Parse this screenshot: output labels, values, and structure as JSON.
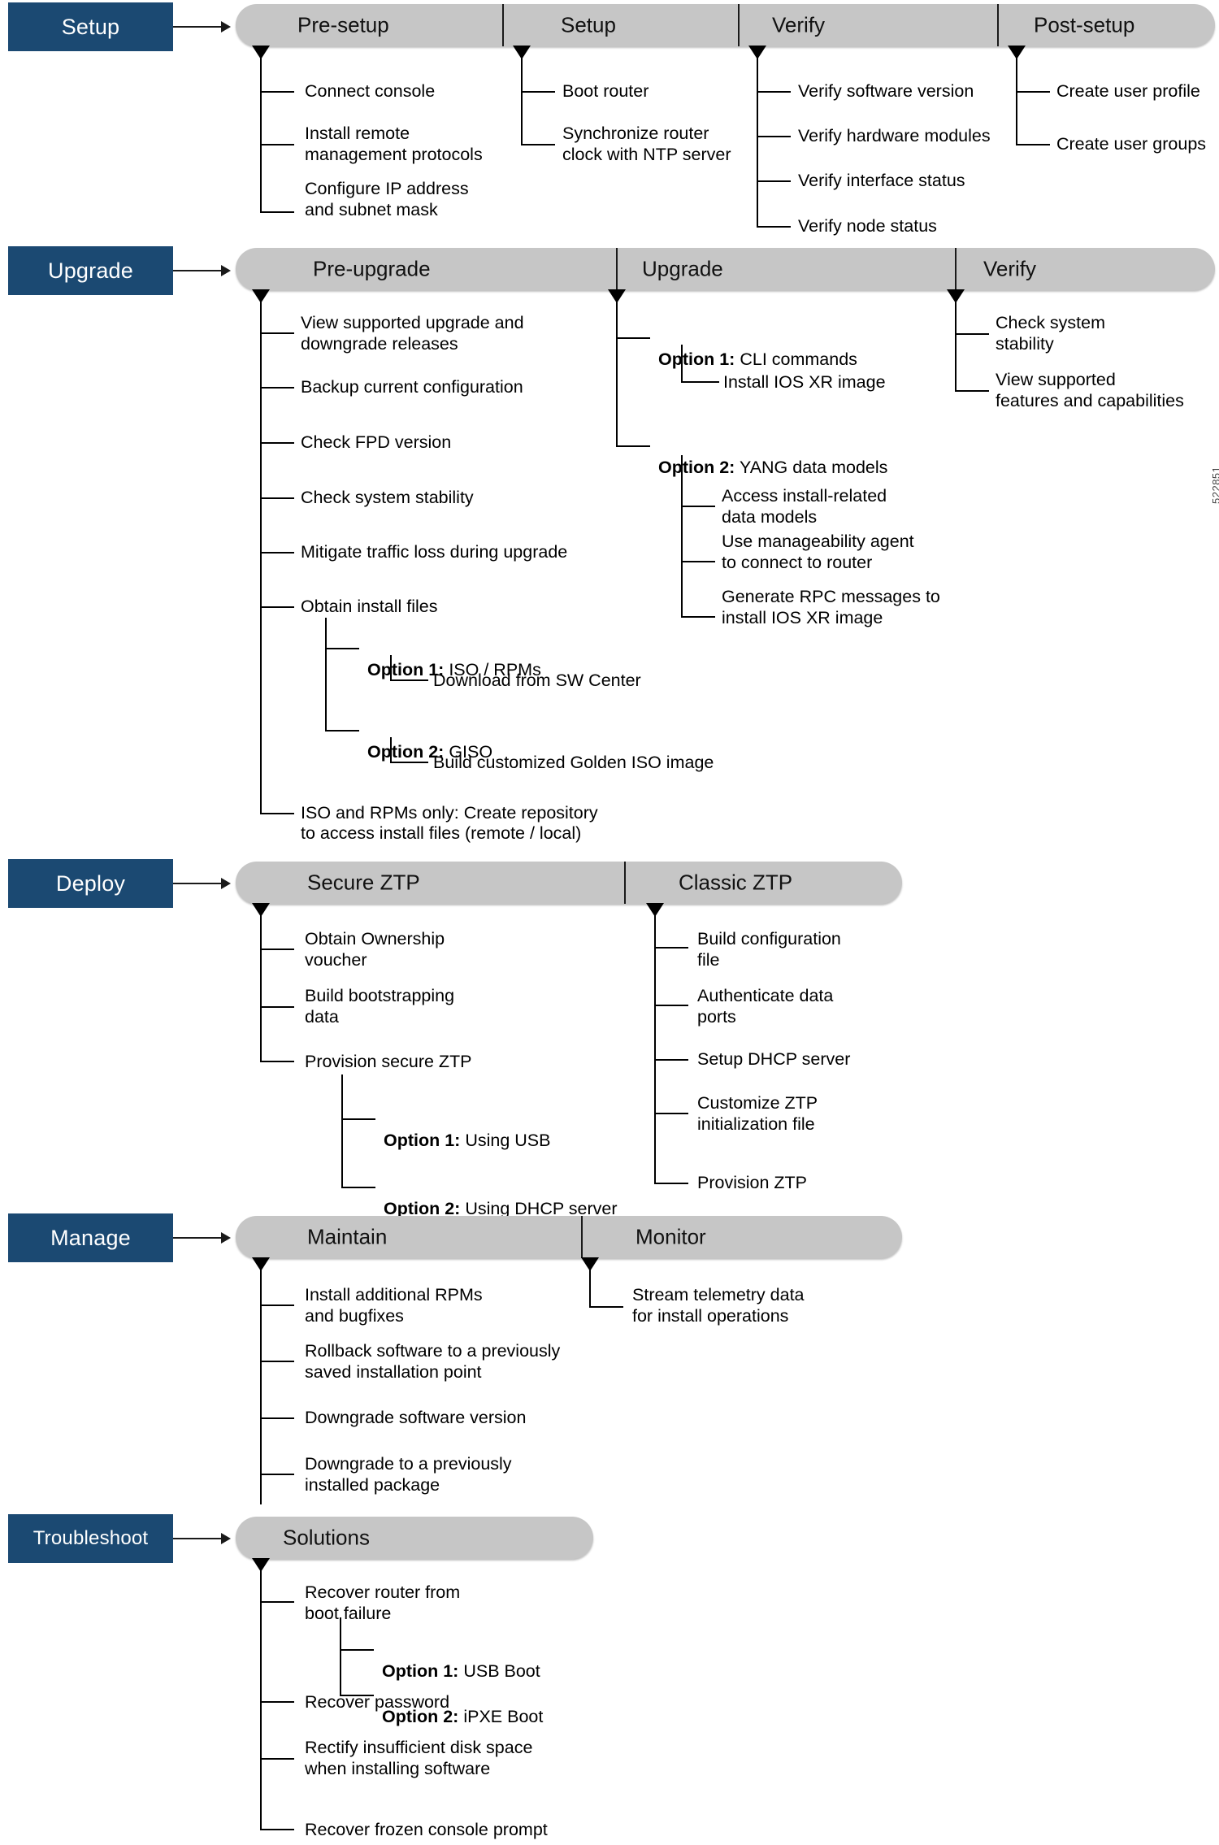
{
  "figure": {
    "id_label": "522851",
    "accent_blue": "#1b4972",
    "bar_gray": "#c6c6c6"
  },
  "rows": [
    {
      "phase": "Setup",
      "stages": [
        {
          "label": "Pre-setup",
          "items": [
            {
              "text": "Connect console"
            },
            {
              "text": "Install remote\nmanagement protocols"
            },
            {
              "text": "Configure IP address\nand subnet mask"
            }
          ]
        },
        {
          "label": "Setup",
          "items": [
            {
              "text": "Boot router"
            },
            {
              "text": "Synchronize router\nclock with NTP server"
            }
          ]
        },
        {
          "label": "Verify",
          "items": [
            {
              "text": "Verify software version"
            },
            {
              "text": "Verify hardware modules"
            },
            {
              "text": "Verify interface status"
            },
            {
              "text": "Verify node status"
            }
          ]
        },
        {
          "label": "Post-setup",
          "items": [
            {
              "text": "Create user profile"
            },
            {
              "text": "Create user groups"
            }
          ]
        }
      ]
    },
    {
      "phase": "Upgrade",
      "stages": [
        {
          "label": "Pre-upgrade",
          "items": [
            {
              "text": "View supported upgrade and\ndowngrade releases"
            },
            {
              "text": "Backup current configuration"
            },
            {
              "text": "Check FPD version"
            },
            {
              "text": "Check system stability"
            },
            {
              "text": "Mitigate traffic loss during upgrade"
            },
            {
              "text": "Obtain install files"
            },
            {
              "bold_prefix": "Option 1:",
              "text": " ISO / RPMs"
            },
            {
              "text": "Download from SW Center"
            },
            {
              "bold_prefix": "Option 2:",
              "text": " GISO"
            },
            {
              "text": "Build customized Golden ISO image"
            },
            {
              "text": "ISO and RPMs only: Create repository\nto access install files (remote / local)"
            }
          ]
        },
        {
          "label": "Upgrade",
          "items": [
            {
              "bold_prefix": "Option 1:",
              "text": " CLI commands"
            },
            {
              "text": "Install IOS XR image"
            },
            {
              "bold_prefix": "Option 2:",
              "text": " YANG data models"
            },
            {
              "text": "Access install-related\ndata models"
            },
            {
              "text": "Use manageability agent\nto connect to router"
            },
            {
              "text": "Generate RPC messages to\ninstall IOS XR image"
            }
          ]
        },
        {
          "label": "Verify",
          "items": [
            {
              "text": "Check system\nstability"
            },
            {
              "text": "View supported\nfeatures and capabilities"
            }
          ]
        }
      ]
    },
    {
      "phase": "Deploy",
      "stages": [
        {
          "label": "Secure ZTP",
          "items": [
            {
              "text": "Obtain Ownership\nvoucher"
            },
            {
              "text": "Build bootstrapping\ndata"
            },
            {
              "text": "Provision secure ZTP"
            },
            {
              "bold_prefix": "Option 1:",
              "text": " Using USB"
            },
            {
              "bold_prefix": "Option 2:",
              "text": " Using DHCP server"
            }
          ]
        },
        {
          "label": "Classic ZTP",
          "items": [
            {
              "text": "Build configuration\nfile"
            },
            {
              "text": "Authenticate data\nports"
            },
            {
              "text": "Setup DHCP server"
            },
            {
              "text": "Customize ZTP\ninitialization file"
            },
            {
              "text": "Provision ZTP"
            }
          ]
        }
      ]
    },
    {
      "phase": "Manage",
      "stages": [
        {
          "label": "Maintain",
          "items": [
            {
              "text": "Install additional RPMs\nand bugfixes"
            },
            {
              "text": "Rollback software to a previously\nsaved installation point"
            },
            {
              "text": "Downgrade software version"
            },
            {
              "text": "Downgrade to a previously\ninstalled package"
            }
          ]
        },
        {
          "label": "Monitor",
          "items": [
            {
              "text": "Stream telemetry data\nfor install operations"
            }
          ]
        }
      ]
    },
    {
      "phase": "Troubleshoot",
      "stages": [
        {
          "label": "Solutions",
          "items": [
            {
              "text": "Recover router from\nboot failure"
            },
            {
              "bold_prefix": "Option 1:",
              "text": " USB Boot"
            },
            {
              "bold_prefix": "Option 2:",
              "text": " iPXE Boot"
            },
            {
              "text": "Recover password"
            },
            {
              "text": "Rectify insufficient disk space\nwhen installing software"
            },
            {
              "text": "Recover frozen console prompt"
            }
          ]
        }
      ]
    }
  ]
}
